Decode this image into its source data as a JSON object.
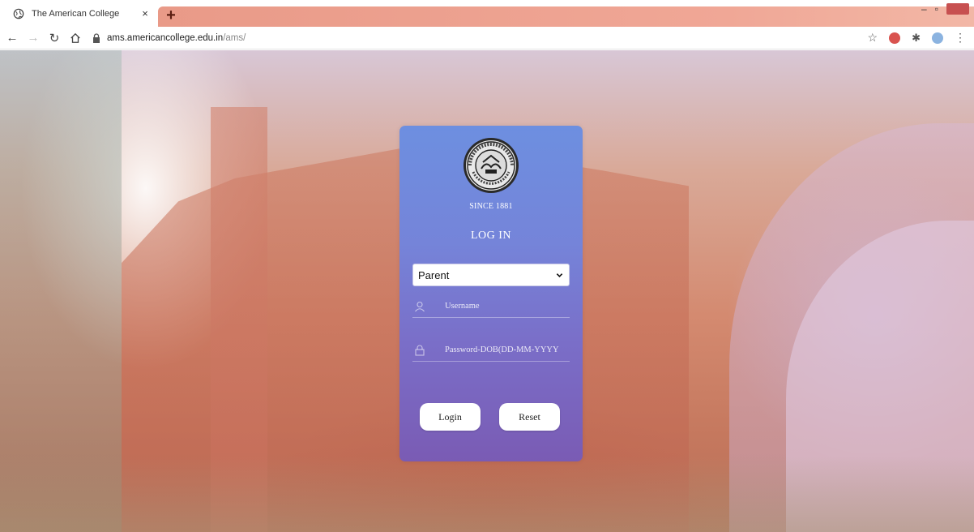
{
  "browser": {
    "tab_title": "The American College",
    "tab_close": "×",
    "new_tab": "+",
    "url_host": "ams.americancollege.edu.in",
    "url_path": "/ams/",
    "icons": [
      "globe-icon",
      "back-icon",
      "forward-icon",
      "reload-icon",
      "home-icon",
      "lock-icon",
      "star-icon",
      "extension-icon",
      "profile-icon",
      "menu-icon"
    ]
  },
  "login": {
    "since": "SINCE 1881",
    "heading": "LOG IN",
    "role_selected": "Parent",
    "username_placeholder": "Username",
    "password_placeholder": "Password-DOB(DD-MM-YYYY",
    "login_label": "Login",
    "reset_label": "Reset"
  },
  "colors": {
    "card_top": "#6d8fe0",
    "card_bottom": "#7a5bb4",
    "tabstrip_accent": "#e99a88"
  }
}
